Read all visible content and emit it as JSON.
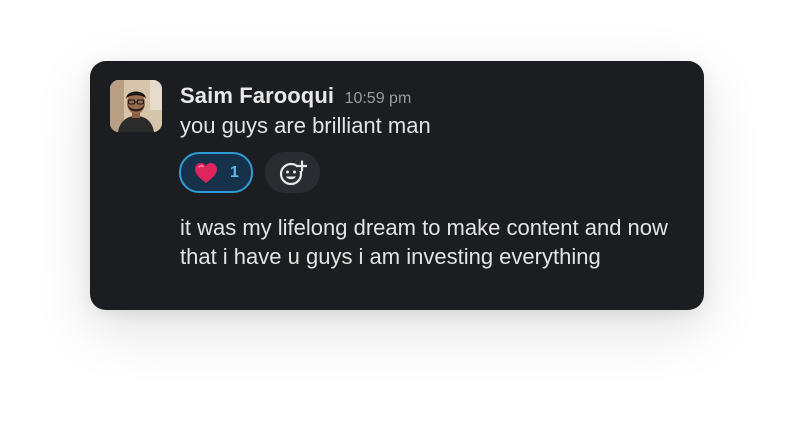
{
  "message": {
    "author": "Saim Farooqui",
    "timestamp": "10:59 pm",
    "text": "you guys are brilliant man",
    "reactions": [
      {
        "emoji": "red-heart",
        "count": "1"
      }
    ],
    "add_reaction_icon": "add-emoji-icon"
  },
  "followup": {
    "text": "it was my lifelong dream to make content and now that i have u guys i am investing everything"
  },
  "colors": {
    "card_background": "#1b1d21",
    "reaction_border": "#2f9bd6",
    "reaction_count": "#5fb8ea",
    "heart": "#e0245e"
  }
}
